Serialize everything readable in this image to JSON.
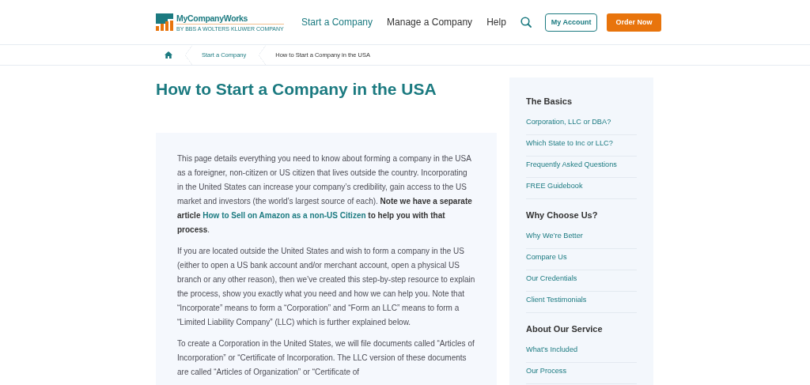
{
  "header": {
    "logo": {
      "name": "MyCompanyWorks",
      "tagline": "BY BBS A WOLTERS KLUWER COMPANY"
    },
    "nav": [
      {
        "label": "Start a Company",
        "selected": true
      },
      {
        "label": "Manage a Company",
        "selected": false
      },
      {
        "label": "Help",
        "selected": false
      }
    ],
    "account_button": "My Account",
    "order_button": "Order Now"
  },
  "breadcrumb": [
    "Start a Company",
    "How to Start a Company in the USA"
  ],
  "title": "How to Start a Company in the USA",
  "article": [
    [
      {
        "kind": "plain",
        "text": "This page details everything you need to know about forming a company in the USA as a foreigner, non-citizen or US citizen that lives outside the country. Incorporating in the United States can increase your company’s credibility, gain access to the US market and investors (the world’s largest source of each). "
      },
      {
        "kind": "bold",
        "text": "Note we have a separate article "
      },
      {
        "kind": "link",
        "text": "How to Sell on Amazon as a non-US Citizen"
      },
      {
        "kind": "bold",
        "text": " to help you with that process"
      },
      {
        "kind": "plain",
        "text": "."
      }
    ],
    [
      {
        "kind": "plain",
        "text": "If you are located outside the United States and wish to form a company in the US (either to open a US bank account and/or merchant account, open a physical US branch or any other reason), then we’ve created this step-by-step resource to explain the process, show you exactly what you need and how we can help you. Note that “Incorporate” means to form a “Corporation” and “Form an LLC” means to form a “Limited Liability Company” (LLC) which is further explained below."
      }
    ],
    [
      {
        "kind": "plain",
        "text": "To create a Corporation in the United States, we will file documents called “Articles of Incorporation” or “Certificate of Incorporation. The LLC version of these documents are called “Articles of Organization” or “Certificate of"
      }
    ]
  ],
  "sidebar": [
    {
      "heading": "The Basics",
      "links": [
        "Corporation, LLC or DBA?",
        "Which State to Inc or LLC?",
        "Frequently Asked Questions",
        "FREE Guidebook"
      ]
    },
    {
      "heading": "Why Choose Us?",
      "links": [
        "Why We’re Better",
        "Compare Us",
        "Our Credentials",
        "Client Testimonials"
      ]
    },
    {
      "heading": "About Our Service",
      "links": [
        "What’s Included",
        "Our Process"
      ]
    }
  ]
}
